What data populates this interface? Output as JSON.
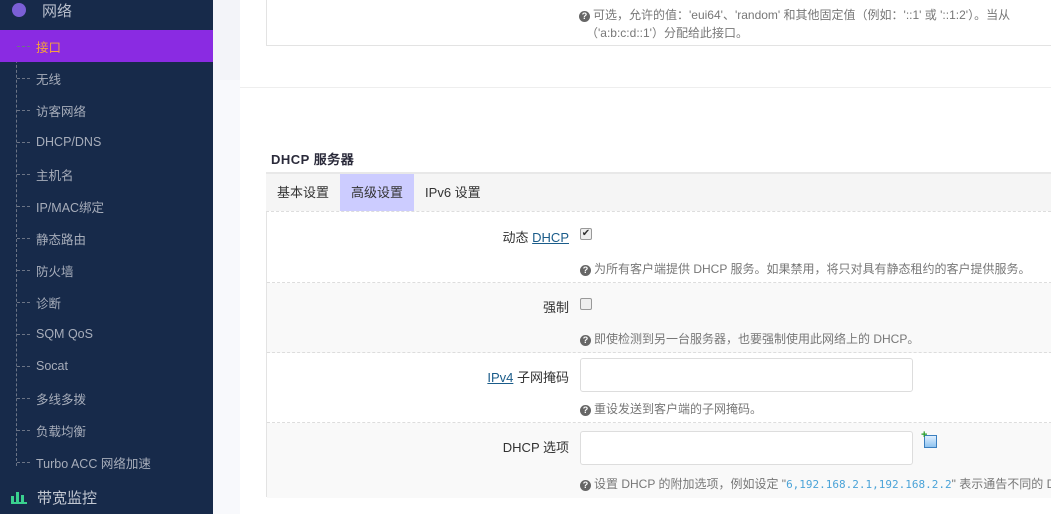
{
  "sidebar": {
    "network": {
      "label": "网络",
      "icon": "globe-icon"
    },
    "items": [
      {
        "label": "接口",
        "active": true
      },
      {
        "label": "无线"
      },
      {
        "label": "访客网络"
      },
      {
        "label": "DHCP/DNS"
      },
      {
        "label": "主机名"
      },
      {
        "label": "IP/MAC绑定"
      },
      {
        "label": "静态路由"
      },
      {
        "label": "防火墙"
      },
      {
        "label": "诊断"
      },
      {
        "label": "SQM QoS"
      },
      {
        "label": "Socat"
      },
      {
        "label": "多线多拨"
      },
      {
        "label": "负载均衡"
      },
      {
        "label": "Turbo ACC 网络加速"
      }
    ],
    "bandwidth": {
      "label": "带宽监控",
      "icon": "bar-chart-icon"
    }
  },
  "top_hint": {
    "line1": "可选，允许的值：'eui64'、'random' 和其他固定值（例如：'::1' 或 '::1:2'）。当从",
    "line2": "（'a:b:c:d::1'）分配给此接口。"
  },
  "section": {
    "title": "DHCP 服务器"
  },
  "tabs": [
    {
      "label": "基本设置"
    },
    {
      "label": "高级设置",
      "active": true
    },
    {
      "label": "IPv6 设置"
    }
  ],
  "rows": [
    {
      "label_pre": "动态 ",
      "label_link": "DHCP",
      "checked": true,
      "hint": "为所有客户端提供 DHCP 服务。如果禁用，将只对具有静态租约的客户提供服务。"
    },
    {
      "label": "强制",
      "checked": false,
      "hint": "即使检测到另一台服务器，也要强制使用此网络上的 DHCP。"
    },
    {
      "label_link": "IPv4",
      "label_post": " 子网掩码",
      "value": "",
      "hint": "重设发送到客户端的子网掩码。"
    },
    {
      "label": "DHCP 选项",
      "value": "",
      "hint_pre": "设置 DHCP 的附加选项，例如设定 \"",
      "hint_code": "6,192.168.2.1,192.168.2.2",
      "hint_post": "\" 表示通告不同的 D"
    }
  ],
  "colors": {
    "sidebar": "#172a4a",
    "active": "#8a2be2",
    "active_text": "#f7a23c",
    "active_tab": "#ccccff"
  }
}
